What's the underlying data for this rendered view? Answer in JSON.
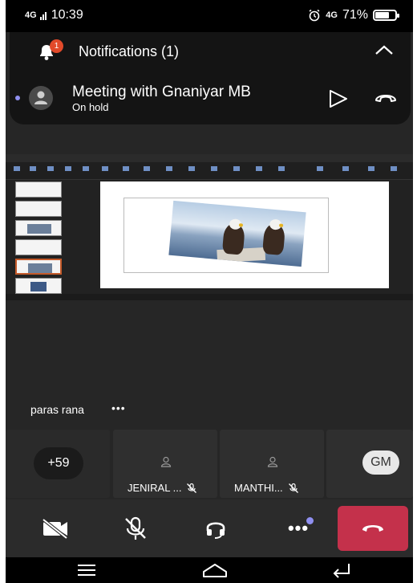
{
  "status_bar": {
    "network": "4G",
    "time": "10:39",
    "secondary_network": "4G",
    "battery_percent": "71%",
    "battery_level": 0.71
  },
  "notification": {
    "title": "Notifications (1)",
    "badge_count": "1"
  },
  "call": {
    "title": "Meeting with Gnaniyar MB",
    "status": "On hold"
  },
  "presenter": {
    "name": "paras rana",
    "more": "•••"
  },
  "participants": {
    "overflow_count": "+59",
    "tiles": [
      {
        "name": "JENIRAL ..."
      },
      {
        "name": "MANTHI..."
      }
    ],
    "partial_initials": "GM"
  },
  "controls": {
    "camera": "camera-off-icon",
    "mic": "mic-off-icon",
    "audio": "headset-icon",
    "more": "•••",
    "leave": "leave-call-icon"
  },
  "colors": {
    "leave": "#c4314b",
    "accent_dot": "#8f8ff0",
    "badge": "#e24a2a"
  }
}
